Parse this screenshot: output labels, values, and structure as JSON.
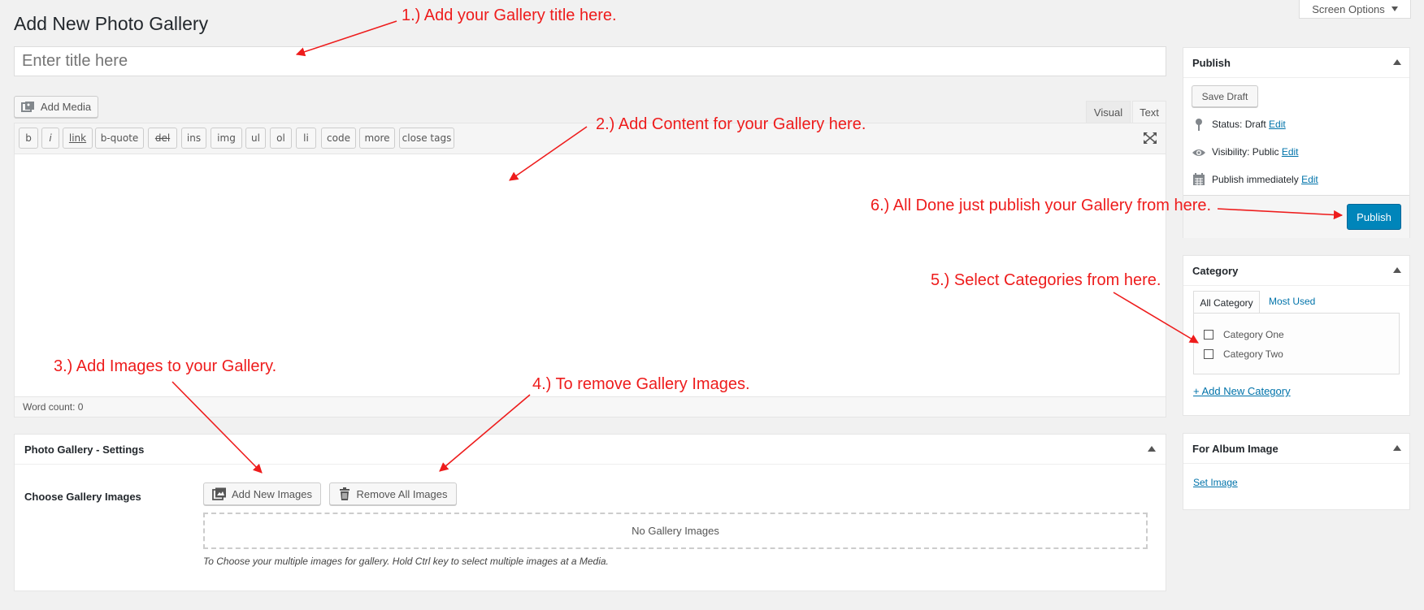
{
  "page": {
    "title": "Add New Photo Gallery",
    "screen_options": "Screen Options",
    "title_placeholder": "Enter title here"
  },
  "editor": {
    "add_media": "Add Media",
    "tab_visual": "Visual",
    "tab_text": "Text",
    "quicktags": [
      "b",
      "i",
      "link",
      "b-quote",
      "del",
      "ins",
      "img",
      "ul",
      "ol",
      "li",
      "code",
      "more",
      "close tags"
    ],
    "word_count": "Word count: 0"
  },
  "settings": {
    "heading": "Photo Gallery - Settings",
    "choose_label": "Choose Gallery Images",
    "add_new_images": "Add New Images",
    "remove_all_images": "Remove All Images",
    "no_images": "No Gallery Images",
    "hint": "To Choose your multiple images for gallery. Hold Ctrl key to select multiple images at a Media."
  },
  "publish": {
    "heading": "Publish",
    "save_draft": "Save Draft",
    "status_label": "Status: ",
    "status_value": "Draft",
    "visibility_label": "Visibility: ",
    "visibility_value": "Public",
    "publish_label": "Publish ",
    "publish_value": "immediately",
    "edit": "Edit",
    "publish_button": "Publish"
  },
  "category": {
    "heading": "Category",
    "tab_all": "All Category",
    "tab_most_used": "Most Used",
    "items": [
      "Category One",
      "Category Two"
    ],
    "add_new": "+ Add New Category"
  },
  "album": {
    "heading": "For Album Image",
    "set_image": "Set Image"
  },
  "annotations": {
    "a1": "1.) Add your Gallery title here.",
    "a2": "2.) Add Content for your Gallery here.",
    "a3": "3.) Add Images to your Gallery.",
    "a4": "4.) To remove Gallery Images.",
    "a5": "5.) Select Categories from here.",
    "a6": "6.) All Done just publish your Gallery from here."
  },
  "colors": {
    "annotation": "#ee1c1c",
    "primary_button": "#0085ba",
    "link": "#0073aa"
  }
}
